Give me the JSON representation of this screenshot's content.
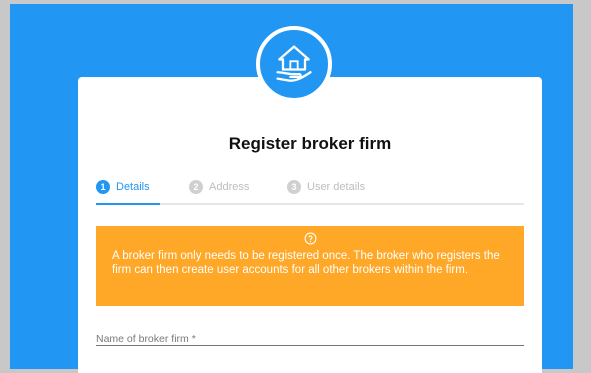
{
  "logo": {
    "icon": "house-in-hand-icon",
    "color": "#2196f3"
  },
  "title": "Register broker firm",
  "steps": [
    {
      "number": "1",
      "label": "Details",
      "state": "active"
    },
    {
      "number": "2",
      "label": "Address",
      "state": "inactive"
    },
    {
      "number": "3",
      "label": "User details",
      "state": "inactive"
    }
  ],
  "alert": {
    "icon": "help-circle-icon",
    "text": "A broker firm only needs to be registered once. The broker who registers the firm can then create user accounts for all other brokers within the firm.",
    "color": "#ffa726"
  },
  "form": {
    "broker_firm_name": {
      "placeholder": "Name of broker firm *",
      "value": ""
    }
  },
  "colors": {
    "accent": "#2196f3",
    "background": "#c8c8c8",
    "card": "#ffffff"
  }
}
